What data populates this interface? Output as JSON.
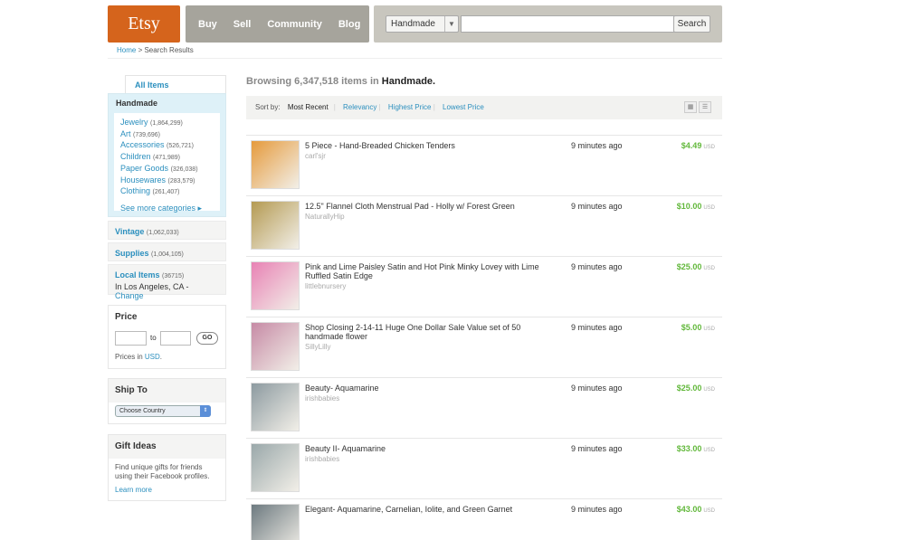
{
  "header": {
    "logo": "Etsy",
    "nav": [
      "Buy",
      "Sell",
      "Community",
      "Blog"
    ],
    "search_category": "Handmade",
    "search_button": "Search"
  },
  "breadcrumb": {
    "home": "Home",
    "sep": " > ",
    "current": "Search Results"
  },
  "sidebar": {
    "all_items_tab": "All Items",
    "handmade": {
      "title": "Handmade",
      "categories": [
        {
          "label": "Jewelry",
          "count": "(1,864,299)"
        },
        {
          "label": "Art",
          "count": "(739,696)"
        },
        {
          "label": "Accessories",
          "count": "(526,721)"
        },
        {
          "label": "Children",
          "count": "(471,989)"
        },
        {
          "label": "Paper Goods",
          "count": "(326,038)"
        },
        {
          "label": "Housewares",
          "count": "(283,579)"
        },
        {
          "label": "Clothing",
          "count": "(261,407)"
        }
      ],
      "see_more": "See more categories ▸"
    },
    "vintage": {
      "label": "Vintage",
      "count": "(1,062,033)"
    },
    "supplies": {
      "label": "Supplies",
      "count": "(1,004,105)"
    },
    "local": {
      "label": "Local Items",
      "count": "(36715)",
      "location": "In Los Angeles, CA - ",
      "change": "Change"
    },
    "price": {
      "title": "Price",
      "to": "to",
      "go": "GO",
      "note": "Prices in ",
      "currency": "USD",
      "period": "."
    },
    "ship_to": {
      "title": "Ship To",
      "select": "Choose Country"
    },
    "gift_ideas": {
      "title": "Gift Ideas",
      "text": "Find unique gifts for friends using their Facebook profiles.",
      "link": "Learn more"
    }
  },
  "main": {
    "browsing_prefix": "Browsing 6,347,518 items in ",
    "browsing_category": "Handmade.",
    "sort": {
      "label": "Sort by:",
      "options": [
        "Most Recent",
        "Relevancy",
        "Highest Price",
        "Lowest Price"
      ]
    },
    "items": [
      {
        "title": "5 Piece - Hand-Breaded Chicken Tenders",
        "shop": "carl'sjr",
        "time": "9 minutes ago",
        "price": "$4.49",
        "currency": "USD",
        "color": "#e59a3c"
      },
      {
        "title": "12.5\" Flannel Cloth Menstrual Pad - Holly w/ Forest Green",
        "shop": "NaturallyHip",
        "time": "9 minutes ago",
        "price": "$10.00",
        "currency": "USD",
        "color": "#b49a52"
      },
      {
        "title": "Pink and Lime Paisley Satin and Hot Pink Minky Lovey with Lime Ruffled Satin Edge",
        "shop": "littlebnursery",
        "time": "9 minutes ago",
        "price": "$25.00",
        "currency": "USD",
        "color": "#e882b4"
      },
      {
        "title": "Shop Closing 2-14-11 Huge One Dollar Sale Value set of 50 handmade flower",
        "shop": "SillyLilly",
        "time": "9 minutes ago",
        "price": "$5.00",
        "currency": "USD",
        "color": "#c68aa5"
      },
      {
        "title": "Beauty- Aquamarine",
        "shop": "irishbabies",
        "time": "9 minutes ago",
        "price": "$25.00",
        "currency": "USD",
        "color": "#8c9aa0"
      },
      {
        "title": "Beauty II- Aquamarine",
        "shop": "irishbabies",
        "time": "9 minutes ago",
        "price": "$33.00",
        "currency": "USD",
        "color": "#9aa8aa"
      },
      {
        "title": "Elegant- Aquamarine, Carnelian, Iolite, and Green Garnet",
        "shop": "",
        "time": "9 minutes ago",
        "price": "$43.00",
        "currency": "USD",
        "color": "#6d7a80"
      }
    ]
  }
}
